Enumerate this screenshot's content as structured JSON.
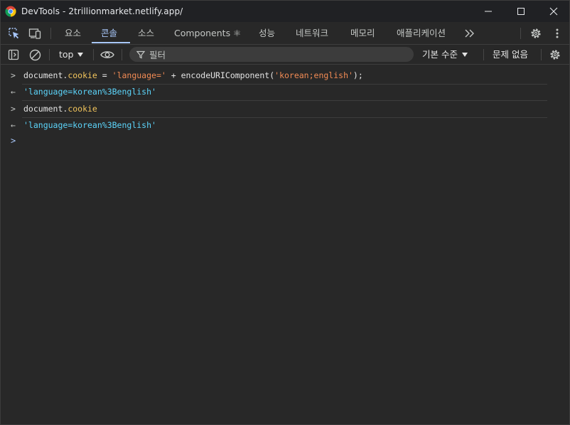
{
  "window": {
    "title": "DevTools - 2trillionmarket.netlify.app/",
    "minimize_label": "minimize",
    "maximize_label": "maximize",
    "close_label": "close"
  },
  "tabs": [
    {
      "label": "요소",
      "active": false
    },
    {
      "label": "콘솔",
      "active": true
    },
    {
      "label": "소스",
      "active": false
    },
    {
      "label": "Components ⚛",
      "active": false
    },
    {
      "label": "성능",
      "active": false
    },
    {
      "label": "네트워크",
      "active": false
    },
    {
      "label": "메모리",
      "active": false
    },
    {
      "label": "애플리케이션",
      "active": false
    }
  ],
  "console_toolbar": {
    "context": "top",
    "filter_placeholder": "필터",
    "levels": "기본 수준",
    "issues": "문제 없음"
  },
  "console": {
    "entries": [
      {
        "type": "input",
        "prompt": ">",
        "tokens": [
          {
            "t": "document.",
            "c": "plain"
          },
          {
            "t": "cookie",
            "c": "prop"
          },
          {
            "t": " = ",
            "c": "plain"
          },
          {
            "t": "'language='",
            "c": "str"
          },
          {
            "t": " + encodeURIComponent(",
            "c": "plain"
          },
          {
            "t": "'korean;english'",
            "c": "str"
          },
          {
            "t": ");",
            "c": "plain"
          }
        ]
      },
      {
        "type": "output",
        "prompt": "←",
        "text": "'language=korean%3Benglish'"
      },
      {
        "type": "input",
        "prompt": ">",
        "tokens": [
          {
            "t": "document.",
            "c": "plain"
          },
          {
            "t": "cookie",
            "c": "prop"
          }
        ]
      },
      {
        "type": "output",
        "prompt": "←",
        "text": "'language=korean%3Benglish'"
      }
    ],
    "input_prompt": ">"
  },
  "colors": {
    "background": "#282828",
    "accent": "#a8c7fa",
    "string": "#f28b54",
    "property": "#f2c55c",
    "result": "#5cd5fb"
  }
}
